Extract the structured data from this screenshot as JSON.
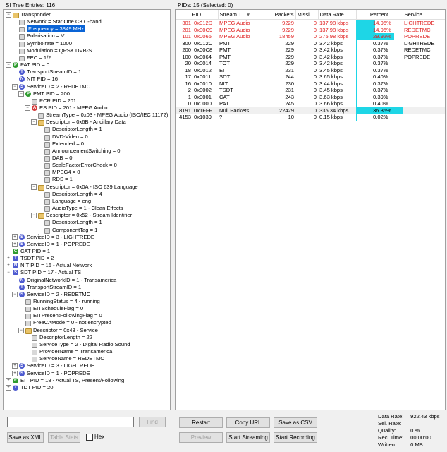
{
  "tree": {
    "header": "SI Tree Entries: 116",
    "rows": [
      {
        "d": 0,
        "exp": "-",
        "icon": "folder",
        "text": "Transponder"
      },
      {
        "d": 1,
        "icon": "leaf",
        "text": "Network = Star One C3 C-band"
      },
      {
        "d": 1,
        "icon": "leaf",
        "text": "Frequency = 3849 MHz",
        "sel": true
      },
      {
        "d": 1,
        "icon": "leaf",
        "text": "Polarisation = V"
      },
      {
        "d": 1,
        "icon": "leaf",
        "text": "Symbolrate = 1000"
      },
      {
        "d": 1,
        "icon": "leaf",
        "text": "Modulation = QPSK DVB-S"
      },
      {
        "d": 1,
        "icon": "leaf",
        "text": "FEC = 1/2"
      },
      {
        "d": 0,
        "exp": "-",
        "icon": "P",
        "text": "PAT PID = 0"
      },
      {
        "d": 1,
        "icon": "T",
        "text": "TransportStreamID = 1"
      },
      {
        "d": 1,
        "icon": "N",
        "text": "NIT PID = 16"
      },
      {
        "d": 1,
        "exp": "-",
        "icon": "S",
        "text": "ServiceID = 2 - REDETMC"
      },
      {
        "d": 2,
        "exp": "-",
        "icon": "P",
        "text": "PMT PID = 200"
      },
      {
        "d": 3,
        "icon": "leaf",
        "text": "PCR PID = 201"
      },
      {
        "d": 3,
        "exp": "-",
        "icon": "A",
        "text": "ES PID = 201 - MPEG Audio"
      },
      {
        "d": 4,
        "icon": "leaf",
        "text": "StreamType = 0x03 - MPEG Audio (ISO/IEC 11172)"
      },
      {
        "d": 4,
        "exp": "-",
        "icon": "folder",
        "text": "Descriptor = 0x6B - Ancillary Data"
      },
      {
        "d": 5,
        "icon": "leaf",
        "text": "DescriptorLength = 1"
      },
      {
        "d": 5,
        "icon": "leaf",
        "text": "DVD-Video = 0"
      },
      {
        "d": 5,
        "icon": "leaf",
        "text": "Extended = 0"
      },
      {
        "d": 5,
        "icon": "leaf",
        "text": "AnnouncementSwitching = 0"
      },
      {
        "d": 5,
        "icon": "leaf",
        "text": "DAB = 0"
      },
      {
        "d": 5,
        "icon": "leaf",
        "text": "ScaleFactorErrorCheck = 0"
      },
      {
        "d": 5,
        "icon": "leaf",
        "text": "MPEG4 = 0"
      },
      {
        "d": 5,
        "icon": "leaf",
        "text": "RDS = 1"
      },
      {
        "d": 4,
        "exp": "-",
        "icon": "folder",
        "text": "Descriptor = 0x0A - ISO 639 Language"
      },
      {
        "d": 5,
        "icon": "leaf",
        "text": "DescriptorLength = 4"
      },
      {
        "d": 5,
        "icon": "leaf",
        "text": "Language = eng"
      },
      {
        "d": 5,
        "icon": "leaf",
        "text": "AudioType = 1 - Clean Effects"
      },
      {
        "d": 4,
        "exp": "-",
        "icon": "folder",
        "text": "Descriptor = 0x52 - Stream Identifier"
      },
      {
        "d": 5,
        "icon": "leaf",
        "text": "DescriptorLength = 1"
      },
      {
        "d": 5,
        "icon": "leaf",
        "text": "ComponentTag = 1"
      },
      {
        "d": 1,
        "exp": "+",
        "icon": "S",
        "text": "ServiceID = 3 - LIGHTREDE"
      },
      {
        "d": 1,
        "exp": "+",
        "icon": "S",
        "text": "ServiceID = 1 - POPREDE"
      },
      {
        "d": 0,
        "icon": "C",
        "text": "CAT PID = 1"
      },
      {
        "d": 0,
        "exp": "+",
        "icon": "T",
        "text": "TSDT PID = 2"
      },
      {
        "d": 0,
        "exp": "+",
        "icon": "N",
        "text": "NIT PID = 16 - Actual Network"
      },
      {
        "d": 0,
        "exp": "-",
        "icon": "S",
        "text": "SDT PID = 17 - Actual TS"
      },
      {
        "d": 1,
        "icon": "N",
        "text": "OriginalNetworkID = 1 - Transamerica"
      },
      {
        "d": 1,
        "icon": "T",
        "text": "TransportStreamID = 1"
      },
      {
        "d": 1,
        "exp": "-",
        "icon": "S",
        "text": "ServiceID = 2 - REDETMC"
      },
      {
        "d": 2,
        "icon": "leaf",
        "text": "RunningStatus = 4 - running"
      },
      {
        "d": 2,
        "icon": "leaf",
        "text": "EITScheduleFlag = 0"
      },
      {
        "d": 2,
        "icon": "leaf",
        "text": "EITPresentFollowingFlag = 0"
      },
      {
        "d": 2,
        "icon": "leaf",
        "text": "FreeCAMode = 0 - not encrypted"
      },
      {
        "d": 2,
        "exp": "-",
        "icon": "folder",
        "text": "Descriptor = 0x48 - Service"
      },
      {
        "d": 3,
        "icon": "leaf",
        "text": "DescriptorLength = 22"
      },
      {
        "d": 3,
        "icon": "leaf",
        "text": "ServiceType = 2 - Digital Radio Sound"
      },
      {
        "d": 3,
        "icon": "leaf",
        "text": "ProviderName = Transamerica"
      },
      {
        "d": 3,
        "icon": "leaf",
        "text": "ServiceName = REDETMC"
      },
      {
        "d": 1,
        "exp": "+",
        "icon": "S",
        "text": "ServiceID = 3 - LIGHTREDE"
      },
      {
        "d": 1,
        "exp": "+",
        "icon": "S",
        "text": "ServiceID = 1 - POPREDE"
      },
      {
        "d": 0,
        "exp": "+",
        "icon": "E",
        "text": "EIT PID = 18 - Actual TS, Present/Following"
      },
      {
        "d": 0,
        "exp": "+",
        "icon": "T",
        "text": "TDT PID = 20"
      }
    ]
  },
  "pids": {
    "header": "PIDs: 15",
    "selected": "(Selected: 0)",
    "columns": [
      "PID",
      "Stream T...",
      "Packets",
      "Missi...",
      "Data Rate",
      "Percent",
      "Service"
    ],
    "rows": [
      {
        "dec": "301",
        "hex": "0x012D",
        "type": "MPEG Audio",
        "packets": "9229",
        "missing": "0",
        "rate": "137.98 kbps",
        "pct": 14.96,
        "pct_label": "14.96%",
        "service": "LIGHTREDE",
        "red": true
      },
      {
        "dec": "201",
        "hex": "0x00C9",
        "type": "MPEG Audio",
        "packets": "9229",
        "missing": "0",
        "rate": "137.98 kbps",
        "pct": 14.96,
        "pct_label": "14.96%",
        "service": "REDETMC",
        "red": true
      },
      {
        "dec": "101",
        "hex": "0x0065",
        "type": "MPEG Audio",
        "packets": "18459",
        "missing": "0",
        "rate": "275.98 kbps",
        "pct": 29.92,
        "pct_label": "29.92%",
        "service": "POPREDE",
        "red": true
      },
      {
        "dec": "300",
        "hex": "0x012C",
        "type": "PMT",
        "packets": "229",
        "missing": "0",
        "rate": "3.42 kbps",
        "pct": 0.37,
        "pct_label": "0.37%",
        "service": "LIGHTREDE"
      },
      {
        "dec": "200",
        "hex": "0x00C8",
        "type": "PMT",
        "packets": "229",
        "missing": "0",
        "rate": "3.42 kbps",
        "pct": 0.37,
        "pct_label": "0.37%",
        "service": "REDETMC"
      },
      {
        "dec": "100",
        "hex": "0x0064",
        "type": "PMT",
        "packets": "229",
        "missing": "0",
        "rate": "3.42 kbps",
        "pct": 0.37,
        "pct_label": "0.37%",
        "service": "POPREDE"
      },
      {
        "dec": "20",
        "hex": "0x0014",
        "type": "TOT",
        "packets": "229",
        "missing": "0",
        "rate": "3.42 kbps",
        "pct": 0.37,
        "pct_label": "0.37%",
        "service": ""
      },
      {
        "dec": "18",
        "hex": "0x0012",
        "type": "EIT",
        "packets": "231",
        "missing": "0",
        "rate": "3.45 kbps",
        "pct": 0.37,
        "pct_label": "0.37%",
        "service": ""
      },
      {
        "dec": "17",
        "hex": "0x0011",
        "type": "SDT",
        "packets": "244",
        "missing": "0",
        "rate": "3.65 kbps",
        "pct": 0.4,
        "pct_label": "0.40%",
        "service": ""
      },
      {
        "dec": "16",
        "hex": "0x0010",
        "type": "NIT",
        "packets": "230",
        "missing": "0",
        "rate": "3.44 kbps",
        "pct": 0.37,
        "pct_label": "0.37%",
        "service": ""
      },
      {
        "dec": "2",
        "hex": "0x0002",
        "type": "TSDT",
        "packets": "231",
        "missing": "0",
        "rate": "3.45 kbps",
        "pct": 0.37,
        "pct_label": "0.37%",
        "service": ""
      },
      {
        "dec": "1",
        "hex": "0x0001",
        "type": "CAT",
        "packets": "243",
        "missing": "0",
        "rate": "3.63 kbps",
        "pct": 0.39,
        "pct_label": "0.39%",
        "service": ""
      },
      {
        "dec": "0",
        "hex": "0x0000",
        "type": "PAT",
        "packets": "245",
        "missing": "0",
        "rate": "3.66 kbps",
        "pct": 0.4,
        "pct_label": "0.40%",
        "service": ""
      },
      {
        "dec": "8191",
        "hex": "0x1FFF",
        "type": "Null Packets",
        "packets": "22429",
        "missing": "0",
        "rate": "335.34 kbps",
        "pct": 36.35,
        "pct_label": "36.35%",
        "service": "",
        "hl": true
      },
      {
        "dec": "4153",
        "hex": "0x1039",
        "type": "?",
        "packets": "10",
        "missing": "0",
        "rate": "0.15 kbps",
        "pct": 0.02,
        "pct_label": "0.02%",
        "service": ""
      }
    ]
  },
  "bottom_left": {
    "find_value": "",
    "find_label": "Find",
    "save_xml_label": "Save as XML",
    "table_stats_label": "Table Stats",
    "hex_label": "Hex"
  },
  "buttons": {
    "restart": "Restart",
    "copy_url": "Copy URL",
    "save_csv": "Save as CSV",
    "preview": "Preview",
    "start_streaming": "Start Streaming",
    "start_recording": "Start Recording"
  },
  "stats": {
    "data_rate_k": "Data Rate:",
    "data_rate_v": "922.43 kbps",
    "sel_rate_k": "Sel. Rate:",
    "sel_rate_v": "",
    "quality_k": "Quality:",
    "quality_v": "0 %",
    "rec_time_k": "Rec. Time:",
    "rec_time_v": "00:00:00",
    "written_k": "Written:",
    "written_v": "0 MB"
  },
  "colors": {
    "selection": "#0a64d6",
    "percent_bar": "#1ed6e6",
    "error_text": "#e02020"
  }
}
